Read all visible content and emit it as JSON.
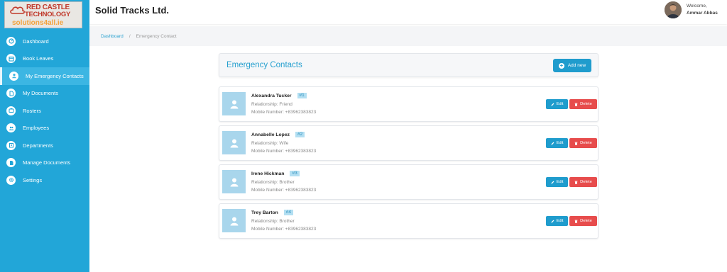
{
  "logo": {
    "line1": "RED CASTLE",
    "line2": "TECHNOLOGY",
    "line3": "solutions4all.ie"
  },
  "sidebar": {
    "items": [
      {
        "label": "Dashboard",
        "icon": "dashboard-icon",
        "active": false
      },
      {
        "label": "Book Leaves",
        "icon": "calendar-icon",
        "active": false
      },
      {
        "label": "My Emergency Contacts",
        "icon": "user-icon",
        "active": true
      },
      {
        "label": "My Documents",
        "icon": "document-icon",
        "active": false
      },
      {
        "label": "Rosters",
        "icon": "roster-icon",
        "active": false
      },
      {
        "label": "Employees",
        "icon": "employees-icon",
        "active": false
      },
      {
        "label": "Departments",
        "icon": "departments-icon",
        "active": false
      },
      {
        "label": "Manage Documents",
        "icon": "manage-documents-icon",
        "active": false
      },
      {
        "label": "Settings",
        "icon": "settings-icon",
        "active": false
      }
    ]
  },
  "header": {
    "company": "Solid Tracks Ltd.",
    "welcome": "Welcome,",
    "username": "Ammar Abbas"
  },
  "breadcrumb": {
    "home": "Dashboard",
    "separator": "/",
    "current": "Emergency Contact"
  },
  "page": {
    "title": "Emergency Contacts",
    "add_label": "Add new"
  },
  "contacts": [
    {
      "name": "Alexandra Tucker",
      "index": "#1",
      "relationship": "Relationship: Friend",
      "mobile": "Mobile Number: +83962383823"
    },
    {
      "name": "Annabelle Lopez",
      "index": "#2",
      "relationship": "Relationship: Wife",
      "mobile": "Mobile Number: +83962383823"
    },
    {
      "name": "Irene Hickman",
      "index": "#3",
      "relationship": "Relationship: Brother",
      "mobile": "Mobile Number: +83962383823"
    },
    {
      "name": "Trey Barton",
      "index": "#4",
      "relationship": "Relationship: Brother",
      "mobile": "Mobile Number: +83962383823"
    }
  ],
  "actions": {
    "edit_label": "Edit",
    "delete_label": "Delete"
  },
  "colors": {
    "sidebar": "#22a6d8",
    "accent": "#1f9ccd",
    "danger": "#e74c4c",
    "photo_placeholder": "#a9d6ec"
  }
}
